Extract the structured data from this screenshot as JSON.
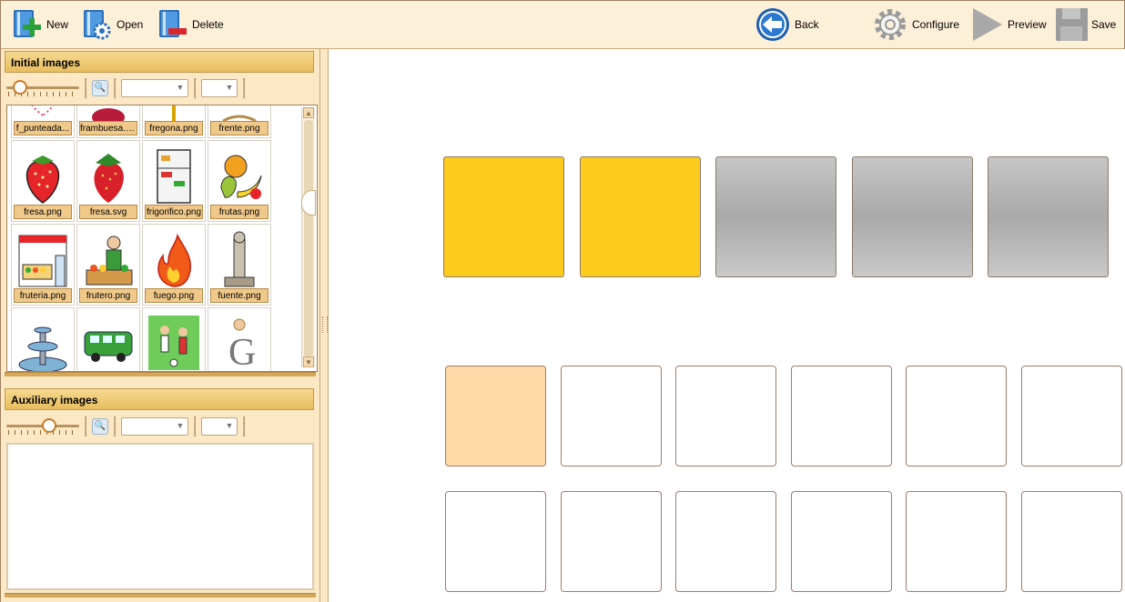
{
  "toolbar": {
    "new_label": "New",
    "open_label": "Open",
    "delete_label": "Delete",
    "back_label": "Back",
    "configure_label": "Configure",
    "preview_label": "Preview",
    "save_label": "Save"
  },
  "initial_panel": {
    "title": "Initial images",
    "zoom_value_pct": 10,
    "filter_value": "",
    "sort_value": "",
    "thumbnails": [
      {
        "caption": "f_punteada...",
        "icon": "dotted-heart-icon"
      },
      {
        "caption": "frambuesa.s...",
        "icon": "raspberry-icon"
      },
      {
        "caption": "fregona.png",
        "icon": "mop-icon"
      },
      {
        "caption": "frente.png",
        "icon": "forehead-icon"
      },
      {
        "caption": "fresa.png",
        "icon": "strawberry-icon"
      },
      {
        "caption": "fresa.svg",
        "icon": "strawberry-photo-icon"
      },
      {
        "caption": "frigorifico.png",
        "icon": "fridge-icon"
      },
      {
        "caption": "frutas.png",
        "icon": "fruits-icon"
      },
      {
        "caption": "fruteria.png",
        "icon": "fruit-shop-icon"
      },
      {
        "caption": "frutero.png",
        "icon": "fruit-seller-icon"
      },
      {
        "caption": "fuego.png",
        "icon": "fire-icon"
      },
      {
        "caption": "fuente.png",
        "icon": "fountain-tap-icon"
      },
      {
        "caption": "",
        "icon": "fountain-icon"
      },
      {
        "caption": "",
        "icon": "van-icon"
      },
      {
        "caption": "",
        "icon": "football-icon"
      },
      {
        "caption": "",
        "icon": "letter-g-icon"
      }
    ]
  },
  "aux_panel": {
    "title": "Auxiliary images",
    "zoom_value_pct": 58,
    "filter_value": "",
    "sort_value": ""
  },
  "workspace": {
    "top_tiles": [
      {
        "style": "yellow"
      },
      {
        "style": "yellow"
      },
      {
        "style": "gray"
      },
      {
        "style": "gray"
      },
      {
        "style": "gray"
      }
    ],
    "slot_rows": [
      [
        {
          "selected": true
        },
        {
          "selected": false
        },
        {
          "selected": false
        },
        {
          "selected": false
        },
        {
          "selected": false
        },
        {
          "selected": false
        }
      ],
      [
        {
          "selected": false
        },
        {
          "selected": false
        },
        {
          "selected": false
        },
        {
          "selected": false
        },
        {
          "selected": false
        },
        {
          "selected": false
        }
      ]
    ]
  },
  "colors": {
    "toolbar_bg": "#fdf0d8",
    "panel_bg": "#fce8c4",
    "header_gold": "#e8bd5e",
    "tile_yellow": "#fccb1d",
    "tile_gray": "#aaaaaa",
    "slot_selected": "#fedaa8"
  }
}
